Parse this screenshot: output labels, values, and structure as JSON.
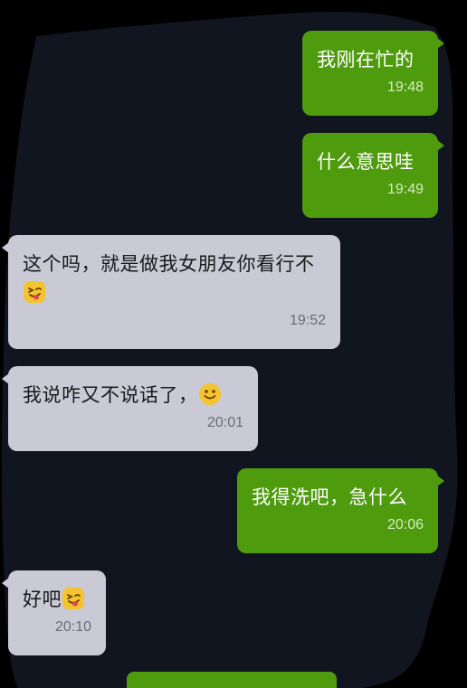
{
  "messages": [
    {
      "id": "m1",
      "side": "out",
      "text": "我刚在忙的",
      "time": "19:48"
    },
    {
      "id": "m2",
      "side": "out",
      "text": "什么意思哇",
      "time": "19:49"
    },
    {
      "id": "m3",
      "side": "in",
      "text": "这个吗，就是做我女朋友你看行不",
      "emoji": "tongue-wink-emoji",
      "time": "19:52"
    },
    {
      "id": "m4",
      "side": "in",
      "text": "我说咋又不说话了，",
      "emoji": "smile-emoji",
      "time": "20:01"
    },
    {
      "id": "m5",
      "side": "out",
      "text": "我得洗吧，急什么",
      "time": "20:06"
    },
    {
      "id": "m6",
      "side": "in",
      "text": "好吧",
      "emoji": "tongue-wink-emoji",
      "time": "20:10"
    }
  ],
  "colors": {
    "outgoing_bubble": "#4f9b0e",
    "incoming_bubble": "#c9cad6",
    "chat_background": "#111520",
    "outer_background": "#000000"
  }
}
